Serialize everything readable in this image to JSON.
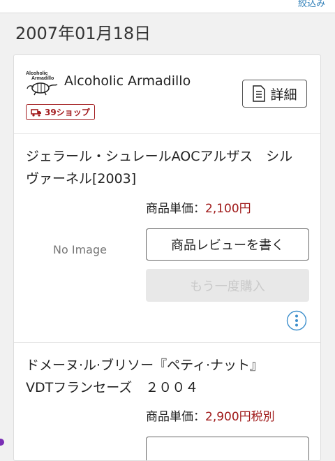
{
  "topbar": {
    "link_label": "絞込み"
  },
  "date_heading": "2007年01月18日",
  "shop": {
    "name": "Alcoholic Armadillo",
    "logo_text_line1": "Alcoholic",
    "logo_text_line2": "Armadillo",
    "badge_label": "39ショップ",
    "detail_button": "詳細"
  },
  "items": [
    {
      "title_line1": "ジェラール・シュレールAOCアルザス　シル",
      "title_line2": "ヴァーネル[2003]",
      "price_label": "商品単価：",
      "price_value": "2,100円",
      "image_placeholder": "No Image",
      "review_button": "商品レビューを書く",
      "rebuy_button": "もう一度購入"
    },
    {
      "title_line1": "ドメーヌ·ル·ブリソー『ペティ·ナット』",
      "title_line2": "VDTフランセーズ　２００４",
      "price_label": "商品単価：",
      "price_value": "2,900円税別"
    }
  ],
  "colors": {
    "accent_red": "#a01a1a",
    "link_blue": "#2f7fb8",
    "disabled_bg": "#e8e8e8"
  }
}
